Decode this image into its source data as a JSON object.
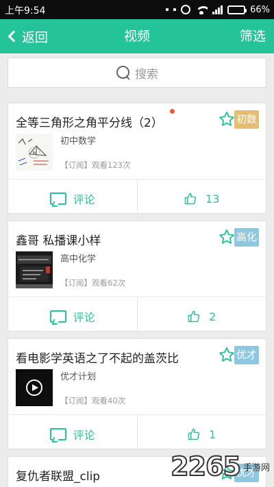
{
  "status_bar": {
    "time": "上午9:54",
    "battery": "66%",
    "battery_level": 0.66
  },
  "nav": {
    "back_label": "返回",
    "title": "视频",
    "filter_label": "筛选"
  },
  "search": {
    "placeholder": "搜索"
  },
  "colors": {
    "accent": "#25c39a",
    "tag_beginner": "#e4bd72",
    "tag_advanced": "#8ec7e0",
    "new_dot": "#f05a28"
  },
  "videos": [
    {
      "title": "全等三角形之角平分线（2）",
      "tag": "初数",
      "subtitle": "初中数学",
      "meta": "【订阅】观看123次",
      "comment_label": "评论",
      "likes": "13",
      "is_new": true,
      "thumb": "math-blackboard"
    },
    {
      "title": "鑫哥 私播课小样",
      "tag": "高化",
      "subtitle": "高中化学",
      "meta": "【订阅】观看62次",
      "comment_label": "评论",
      "likes": "2",
      "is_new": false,
      "thumb": "chemistry-screen"
    },
    {
      "title": "看电影学英语之了不起的盖茨比",
      "tag": "优才",
      "subtitle": "优才计划",
      "meta": "【订阅】观看40次",
      "comment_label": "评论",
      "likes": "1",
      "is_new": false,
      "thumb": "play-icon"
    },
    {
      "title": "复仇者联盟_clip",
      "tag": "优才"
    }
  ],
  "watermark": {
    "number": "2265",
    "sub": "手游网"
  }
}
